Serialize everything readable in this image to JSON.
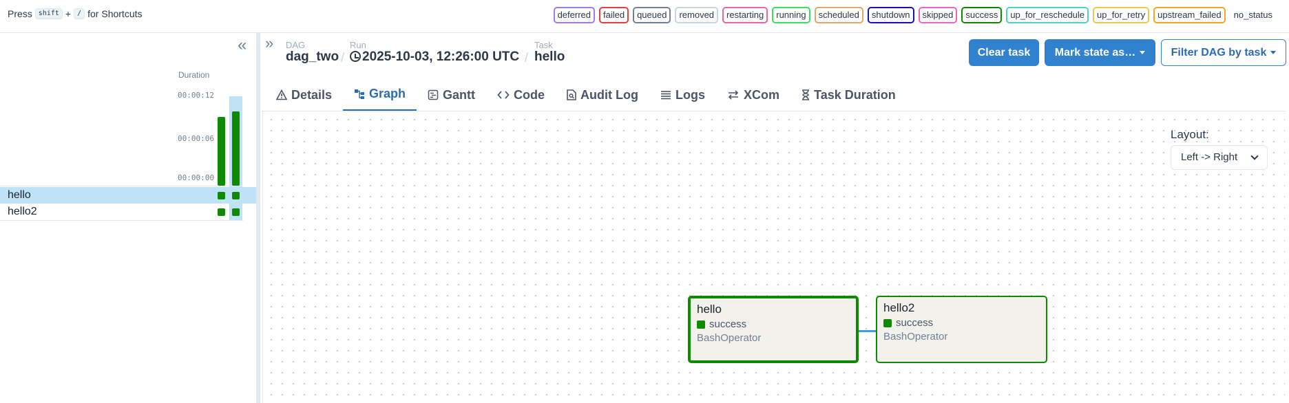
{
  "shortcuts": {
    "press": "Press",
    "key1": "shift",
    "plus": "+",
    "key2": "/",
    "suffix": "for Shortcuts"
  },
  "legend": [
    {
      "label": "deferred",
      "color": "#9f7aea"
    },
    {
      "label": "failed",
      "color": "#e53e3e"
    },
    {
      "label": "queued",
      "color": "#718096"
    },
    {
      "label": "removed",
      "color": "#cbd5e0"
    },
    {
      "label": "restarting",
      "color": "#ed64a6"
    },
    {
      "label": "running",
      "color": "#38e05f"
    },
    {
      "label": "scheduled",
      "color": "#e2a66a"
    },
    {
      "label": "shutdown",
      "color": "#1a0fb8"
    },
    {
      "label": "skipped",
      "color": "#ed64c6"
    },
    {
      "label": "success",
      "color": "#0d8a00"
    },
    {
      "label": "up_for_reschedule",
      "color": "#4fd1c5"
    },
    {
      "label": "up_for_retry",
      "color": "#ecc94b"
    },
    {
      "label": "upstream_failed",
      "color": "#f6a623"
    },
    {
      "label": "no_status",
      "color": ""
    }
  ],
  "grid": {
    "duration_title": "Duration",
    "ticks": [
      "00:00:12",
      "00:00:06",
      "00:00:00"
    ],
    "run_durations_seconds": [
      12,
      13
    ],
    "tasks": [
      {
        "name": "hello",
        "selected": true,
        "states": [
          "success",
          "success"
        ]
      },
      {
        "name": "hello2",
        "selected": false,
        "states": [
          "success",
          "success"
        ]
      }
    ]
  },
  "breadcrumb": {
    "dag_label": "DAG",
    "dag_value": "dag_two",
    "run_label": "Run",
    "run_value": "2025-10-03, 12:26:00 UTC",
    "task_label": "Task",
    "task_value": "hello"
  },
  "actions": {
    "clear": "Clear task",
    "mark": "Mark state as…",
    "filter": "Filter DAG by task"
  },
  "tabs": [
    "Details",
    "Graph",
    "Gantt",
    "Code",
    "Audit Log",
    "Logs",
    "XCom",
    "Task Duration"
  ],
  "active_tab": "Graph",
  "graph": {
    "layout_label": "Layout:",
    "layout_value": "Left -> Right",
    "nodes": [
      {
        "name": "hello",
        "state": "success",
        "operator": "BashOperator",
        "selected": true
      },
      {
        "name": "hello2",
        "state": "success",
        "operator": "BashOperator",
        "selected": false
      }
    ]
  },
  "colors": {
    "accent": "#3182ce",
    "success": "#0d8a00",
    "node_bg": "#f2f1ec",
    "edge": "#4299e1"
  }
}
